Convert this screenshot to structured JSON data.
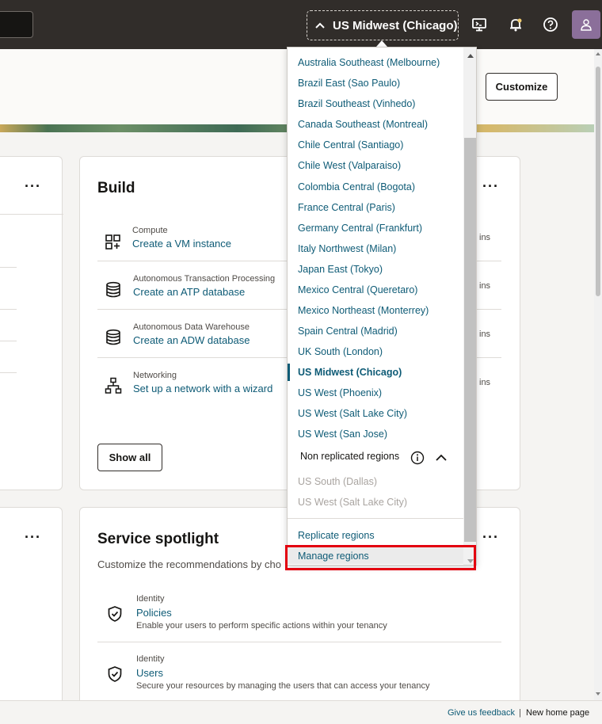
{
  "topbar": {
    "region_selected": "US Midwest (Chicago)",
    "icons": [
      "cloud-shell-icon",
      "notifications-icon",
      "help-icon",
      "profile-icon"
    ]
  },
  "hero": {
    "customize_label": "Customize"
  },
  "build": {
    "title": "Build",
    "items": [
      {
        "category": "Compute",
        "link": "Create a VM instance",
        "icon": "compute-icon",
        "time": "ins"
      },
      {
        "category": "Autonomous Transaction Processing",
        "link": "Create an ATP database",
        "icon": "database-icon",
        "time": "ins"
      },
      {
        "category": "Autonomous Data Warehouse",
        "link": "Create an ADW database",
        "icon": "database-icon",
        "time": "ins"
      },
      {
        "category": "Networking",
        "link": "Set up a network with a wizard",
        "icon": "network-icon",
        "time": "ins"
      }
    ],
    "show_all_label": "Show all"
  },
  "spotlight": {
    "title": "Service spotlight",
    "description": "Customize the recommendations by cho",
    "items": [
      {
        "category": "Identity",
        "link": "Policies",
        "description": "Enable your users to perform specific actions within your tenancy"
      },
      {
        "category": "Identity",
        "link": "Users",
        "description": "Secure your resources by managing the users that can access your tenancy"
      }
    ]
  },
  "region_dropdown": {
    "regions": [
      "Australia Southeast (Melbourne)",
      "Brazil East (Sao Paulo)",
      "Brazil Southeast (Vinhedo)",
      "Canada Southeast (Montreal)",
      "Chile Central (Santiago)",
      "Chile West (Valparaiso)",
      "Colombia Central (Bogota)",
      "France Central (Paris)",
      "Germany Central (Frankfurt)",
      "Italy Northwest (Milan)",
      "Japan East (Tokyo)",
      "Mexico Central (Queretaro)",
      "Mexico Northeast (Monterrey)",
      "Spain Central (Madrid)",
      "UK South (London)",
      "US Midwest (Chicago)",
      "US West (Phoenix)",
      "US West (Salt Lake City)",
      "US West (San Jose)"
    ],
    "selected_index": 15,
    "non_replicated_label": "Non replicated regions",
    "non_replicated": [
      "US South (Dallas)",
      "US West (Salt Lake City)"
    ],
    "replicate_label": "Replicate regions",
    "manage_label": "Manage regions"
  },
  "footer": {
    "feedback": "Give us feedback",
    "separator": "|",
    "new_home": "New home page"
  },
  "colors": {
    "topbar": "#312d2a",
    "link": "#0e5b76",
    "highlight": "#e3000f"
  }
}
